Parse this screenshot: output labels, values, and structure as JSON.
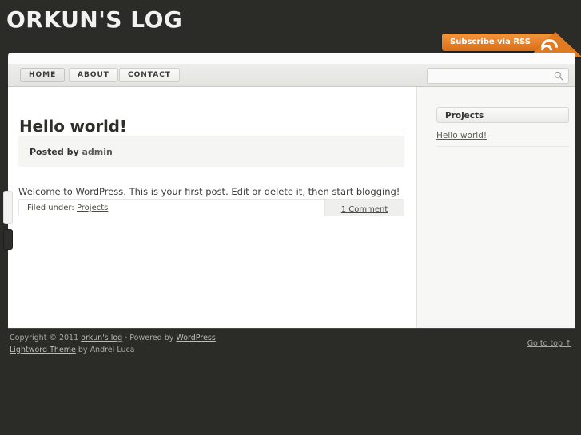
{
  "header": {
    "site_title": "ORKUN'S LOG",
    "background_color": "#2b2b28",
    "title_color": "#f2f2f0"
  },
  "rss": {
    "label": "Subscribe via RSS",
    "icon": "rss-icon",
    "accent_color": "#e8822a"
  },
  "nav": {
    "items": [
      {
        "label": "HOME",
        "active": true
      },
      {
        "label": "ABOUT",
        "active": false
      },
      {
        "label": "CONTACT",
        "active": false
      }
    ]
  },
  "search": {
    "value": "",
    "placeholder": "",
    "icon": "search-icon"
  },
  "post": {
    "title": "Hello world!",
    "meta_prefix": "Posted by",
    "author": "admin",
    "excerpt": "Welcome to WordPress. This is your first post. Edit or delete it, then start blogging!",
    "filed_under_label": "Filed under:",
    "category": "Projects",
    "comments": "1 Comment"
  },
  "sidebar": {
    "widget_title": "Projects",
    "links": [
      {
        "label": "Hello world!"
      }
    ]
  },
  "footer": {
    "copyright_prefix": "Copyright © 2011",
    "site_link": "orkun's log",
    "powered_sep": "· Powered by",
    "platform_link": "WordPress",
    "theme_link": "Lightword Theme",
    "theme_author": "by Andrei Luca",
    "go_to_top": "Go to top ↑"
  }
}
